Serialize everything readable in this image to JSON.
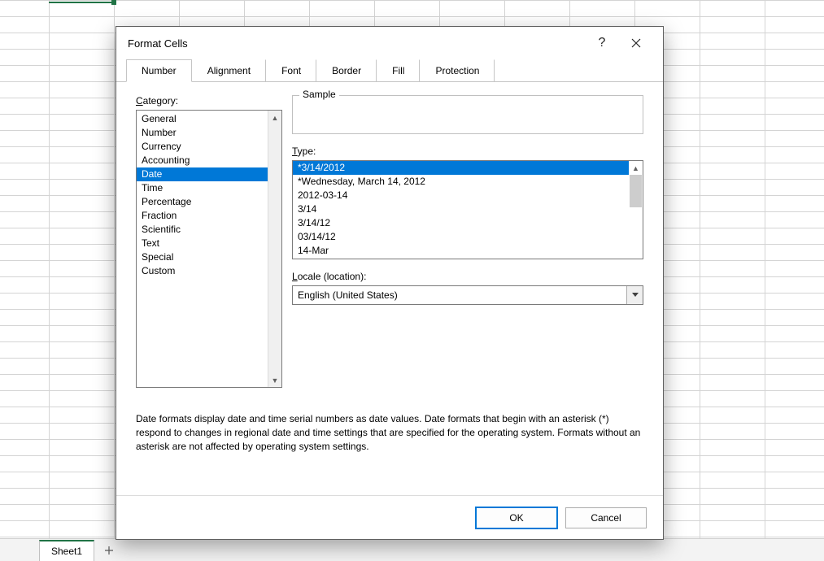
{
  "sheet": {
    "active_tab": "Sheet1"
  },
  "dialog": {
    "title": "Format Cells",
    "tabs": [
      "Number",
      "Alignment",
      "Font",
      "Border",
      "Fill",
      "Protection"
    ],
    "active_tab_index": 0,
    "category_label": "Category:",
    "categories": [
      "General",
      "Number",
      "Currency",
      "Accounting",
      "Date",
      "Time",
      "Percentage",
      "Fraction",
      "Scientific",
      "Text",
      "Special",
      "Custom"
    ],
    "selected_category_index": 4,
    "sample_label": "Sample",
    "type_label": "Type:",
    "types": [
      "*3/14/2012",
      "*Wednesday, March 14, 2012",
      "2012-03-14",
      "3/14",
      "3/14/12",
      "03/14/12",
      "14-Mar"
    ],
    "selected_type_index": 0,
    "locale_label": "Locale (location):",
    "locale_value": "English (United States)",
    "description": "Date formats display date and time serial numbers as date values.  Date formats that begin with an asterisk (*) respond to changes in regional date and time settings that are specified for the operating system. Formats without an asterisk are not affected by operating system settings.",
    "ok_label": "OK",
    "cancel_label": "Cancel"
  }
}
